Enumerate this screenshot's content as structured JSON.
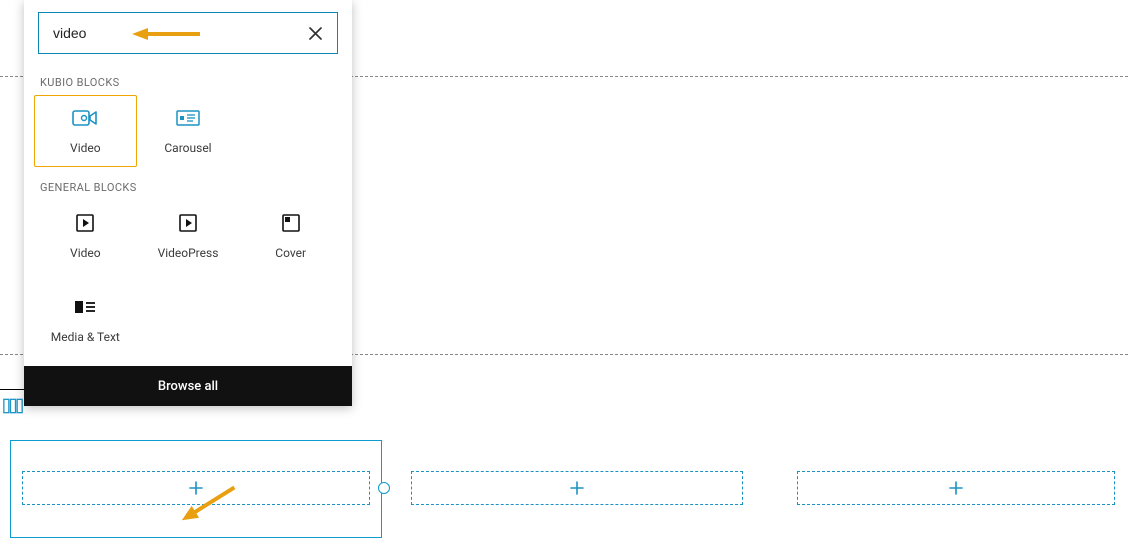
{
  "search": {
    "value": "video"
  },
  "sections": {
    "kubio_label": "KUBIO BLOCKS",
    "general_label": "GENERAL BLOCKS"
  },
  "kubio_blocks": [
    {
      "label": "Video",
      "icon": "video-camera-icon",
      "selected": true
    },
    {
      "label": "Carousel",
      "icon": "carousel-icon",
      "selected": false
    }
  ],
  "general_blocks": [
    {
      "label": "Video",
      "icon": "play-square-icon"
    },
    {
      "label": "VideoPress",
      "icon": "play-square-icon"
    },
    {
      "label": "Cover",
      "icon": "cover-icon"
    },
    {
      "label": "Media & Text",
      "icon": "media-text-icon"
    }
  ],
  "browse_all_label": "Browse all"
}
